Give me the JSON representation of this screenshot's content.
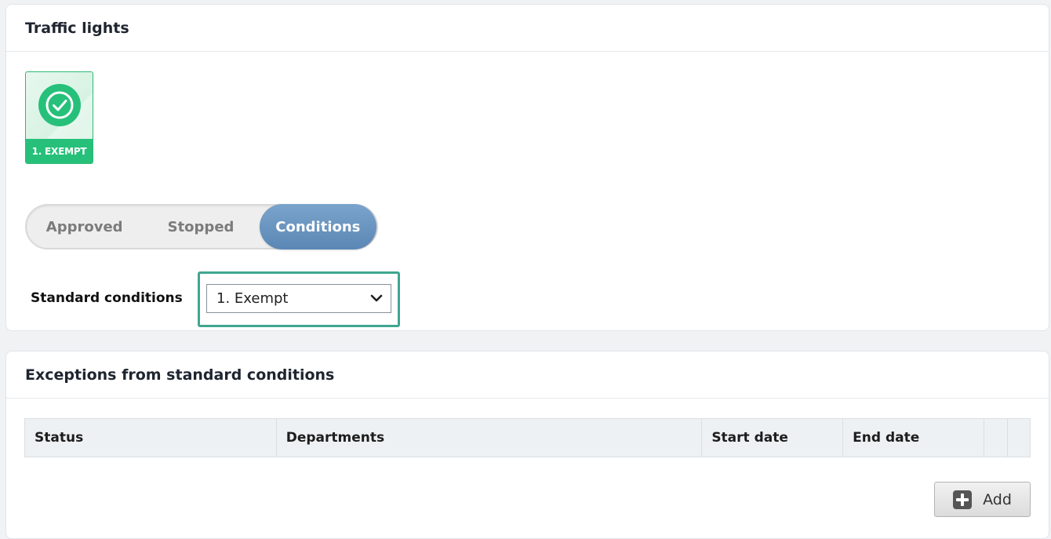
{
  "traffic_lights": {
    "title": "Traffic lights",
    "tile": {
      "label": "1. EXEMPT",
      "icon": "check-circle-icon",
      "color": "#26c07a"
    },
    "segments": [
      {
        "label": "Approved",
        "active": false
      },
      {
        "label": "Stopped",
        "active": false
      },
      {
        "label": "Conditions",
        "active": true
      }
    ],
    "standard_conditions": {
      "label": "Standard conditions",
      "selected": "1. Exempt"
    }
  },
  "exceptions": {
    "title": "Exceptions from standard conditions",
    "columns": [
      "Status",
      "Departments",
      "Start date",
      "End date",
      "",
      ""
    ],
    "rows": [],
    "add_label": "Add",
    "add_icon": "plus-square-icon"
  },
  "colors": {
    "accent_green": "#26c07a",
    "active_segment": "#6a95c1",
    "focus_border": "#3fa690"
  }
}
